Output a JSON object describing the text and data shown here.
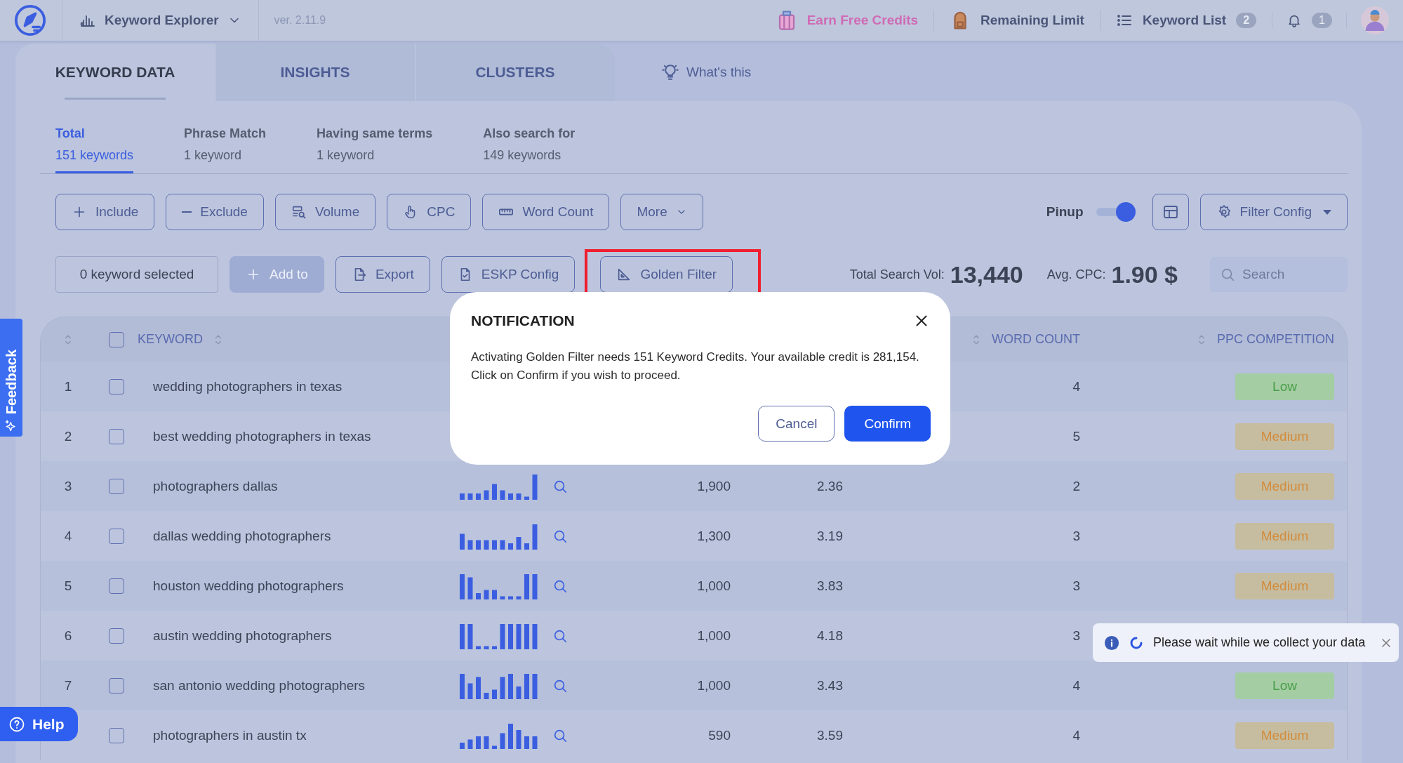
{
  "topbar": {
    "tool": "Keyword Explorer",
    "version": "ver. 2.11.9",
    "earn_credits": "Earn Free Credits",
    "remaining_limit": "Remaining Limit",
    "keyword_list": {
      "label": "Keyword List",
      "count": "2"
    },
    "notifications": {
      "count": "1"
    }
  },
  "tabs": [
    {
      "label": "KEYWORD DATA",
      "selected": true
    },
    {
      "label": "INSIGHTS",
      "selected": false
    },
    {
      "label": "CLUSTERS",
      "selected": false
    }
  ],
  "whats_this": "What's this",
  "subtabs": [
    {
      "title": "Total",
      "count": "151 keywords",
      "selected": true
    },
    {
      "title": "Phrase Match",
      "count": "1 keyword",
      "selected": false
    },
    {
      "title": "Having same terms",
      "count": "1 keyword",
      "selected": false
    },
    {
      "title": "Also search for",
      "count": "149 keywords",
      "selected": false
    }
  ],
  "filters": [
    {
      "label": "Include",
      "kind": "plus"
    },
    {
      "label": "Exclude",
      "kind": "minus"
    },
    {
      "label": "Volume",
      "kind": "volume"
    },
    {
      "label": "CPC",
      "kind": "hand"
    },
    {
      "label": "Word Count",
      "kind": "ruler"
    },
    {
      "label": "More",
      "kind": "more"
    }
  ],
  "pinup": {
    "label": "Pinup",
    "on": true
  },
  "filter_config": "Filter Config",
  "actions": {
    "selected_count": "0 keyword selected",
    "add_to": {
      "label": "Add to",
      "disabled": true
    },
    "export": "Export",
    "eskp_config": "ESKP Config",
    "golden_filter": {
      "label": "Golden Filter",
      "highlighted": true
    }
  },
  "totals": {
    "search_vol_label": "Total Search Vol:",
    "search_vol": "13,440",
    "cpc_label": "Avg. CPC:",
    "cpc": "1.90 $"
  },
  "search": {
    "placeholder": "Search"
  },
  "table": {
    "select_all": {
      "checked": false
    },
    "columns": {
      "keyword": "KEYWORD",
      "word_count": "WORD COUNT",
      "competition": "PPC COMPETITION"
    },
    "rows": [
      {
        "index": "1",
        "checked": false,
        "keyword": "wedding photographers in texas",
        "word_count": "4",
        "competition": {
          "label": "Low",
          "kind": "low"
        }
      },
      {
        "index": "2",
        "checked": false,
        "keyword": "best wedding photographers in texas",
        "word_count": "5",
        "competition": {
          "label": "Medium",
          "kind": "medium"
        }
      },
      {
        "index": "3",
        "checked": false,
        "keyword": "photographers dallas",
        "volume": "1,900",
        "cpc": "2.36",
        "word_count": "2",
        "competition": {
          "label": "Medium",
          "kind": "medium"
        }
      },
      {
        "index": "4",
        "checked": false,
        "keyword": "dallas wedding photographers",
        "volume": "1,300",
        "cpc": "3.19",
        "word_count": "3",
        "competition": {
          "label": "Medium",
          "kind": "medium"
        }
      },
      {
        "index": "5",
        "checked": false,
        "keyword": "houston wedding photographers",
        "volume": "1,000",
        "cpc": "3.83",
        "word_count": "3",
        "competition": {
          "label": "Medium",
          "kind": "medium"
        }
      },
      {
        "index": "6",
        "checked": false,
        "keyword": "austin wedding photographers",
        "volume": "1,000",
        "cpc": "4.18",
        "word_count": "3"
      },
      {
        "index": "7",
        "checked": false,
        "keyword": "san antonio wedding photographers",
        "volume": "1,000",
        "cpc": "3.43",
        "word_count": "4",
        "competition": {
          "label": "Low",
          "kind": "low"
        }
      },
      {
        "checked": false,
        "keyword": "photographers in austin tx",
        "volume": "590",
        "cpc": "3.59",
        "word_count": "4",
        "competition": {
          "label": "Medium",
          "kind": "medium"
        }
      }
    ]
  },
  "dialog": {
    "title": "NOTIFICATION",
    "message": "Activating Golden Filter needs 151 Keyword Credits. Your available credit is 281,154. Click on Confirm if you wish to proceed.",
    "buttons": [
      {
        "label": "Cancel",
        "kind": "secondary"
      },
      {
        "label": "Confirm",
        "kind": "primary"
      }
    ]
  },
  "toast": {
    "message": "Please wait while we collect your data"
  },
  "feedback": "Feedback",
  "help": "Help"
}
